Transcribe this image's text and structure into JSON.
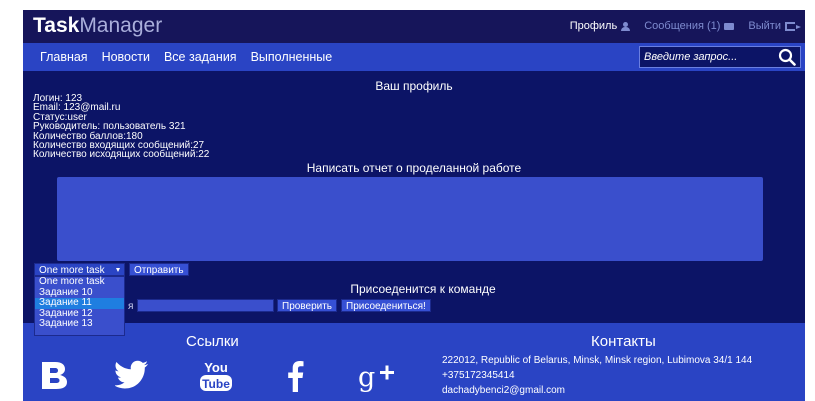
{
  "header": {
    "logo_part1": "Task",
    "logo_part2": "Manager",
    "profile": "Профиль",
    "messages": "Сообщения (1)",
    "logout": "Выйти"
  },
  "nav": {
    "items": [
      "Главная",
      "Новости",
      "Все задания",
      "Выполненные"
    ],
    "search_placeholder": "Введите запрос..."
  },
  "profile": {
    "title": "Ваш профиль",
    "lines": [
      "Логин: 123",
      "Email: 123@mail.ru",
      "Статус:user",
      "Руководитель: пользователь 321",
      "Количество баллов:180",
      "Количество входящих сообщений:27",
      "Количество исходящих сообщений:22"
    ]
  },
  "report": {
    "title": "Написать отчет о проделанной работе",
    "task_selected": "One more task",
    "task_options": [
      "One more task",
      "Задание 10",
      "Задание 11",
      "Задание 12",
      "Задание 13"
    ],
    "task_highlighted_index": 2,
    "send_label": "Отправить"
  },
  "team": {
    "title": "Присоеденится к команде",
    "label_fragment": "я",
    "check_label": "Проверить",
    "join_label": "Присоедениться!"
  },
  "footer": {
    "links_title": "Ссылки",
    "contacts_title": "Контакты",
    "social": [
      "vk-icon",
      "twitter-icon",
      "youtube-icon",
      "facebook-icon",
      "google-plus-icon"
    ],
    "youtube_you": "You",
    "youtube_tube": "Tube",
    "address": "222012, Republic of Belarus, Minsk, Minsk region, Lubimova 34/1 144",
    "phone": "+375172345414",
    "email": "dachadybenci2@gmail.com"
  }
}
